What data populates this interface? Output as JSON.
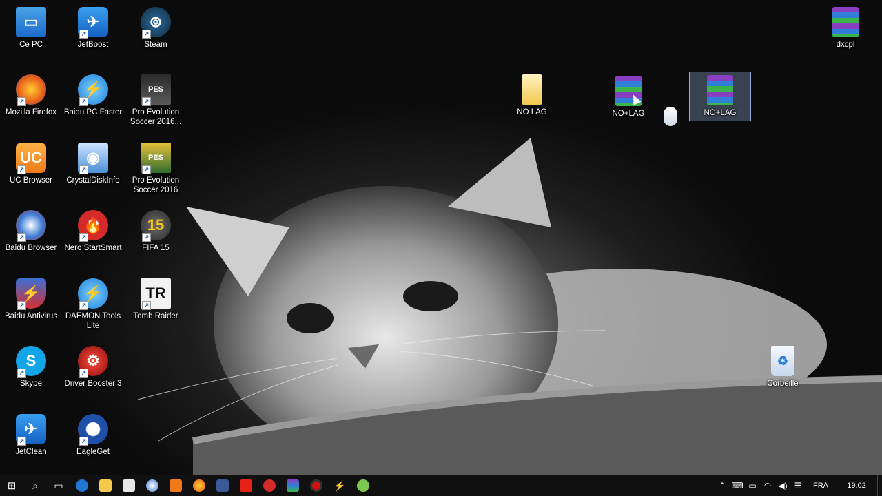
{
  "desktop_icons": {
    "ce_pc": "Ce PC",
    "jetboost": "JetBoost",
    "steam": "Steam",
    "firefox": "Mozilla Firefox",
    "baidu_pc_faster": "Baidu PC Faster",
    "pes_2016_myclub": "Pro Evolution Soccer 2016...",
    "uc_browser": "UC Browser",
    "crystaldiskinfo": "CrystalDiskInfo",
    "pes_2016": "Pro Evolution Soccer 2016",
    "baidu_browser": "Baidu Browser",
    "nero": "Nero StartSmart",
    "fifa15": "FIFA 15",
    "baidu_antivirus": "Baidu Antivirus",
    "daemon_tools": "DAEMON Tools Lite",
    "tomb_raider": "Tomb Raider",
    "skype": "Skype",
    "driver_booster": "Driver Booster 3",
    "jetclean": "JetClean",
    "eagleget": "EagleGet",
    "no_lag_folder": "NO LAG",
    "no_lag_rar": "NO+LAG",
    "no_lag_rar_selected": "NO+LAG",
    "dxcpl": "dxcpl",
    "recycle_bin": "Corbeille"
  },
  "taskbar": {
    "language": "FRA",
    "time": "19:02"
  },
  "colors": {
    "taskbar": "#101010",
    "selection": "#8caad2"
  }
}
